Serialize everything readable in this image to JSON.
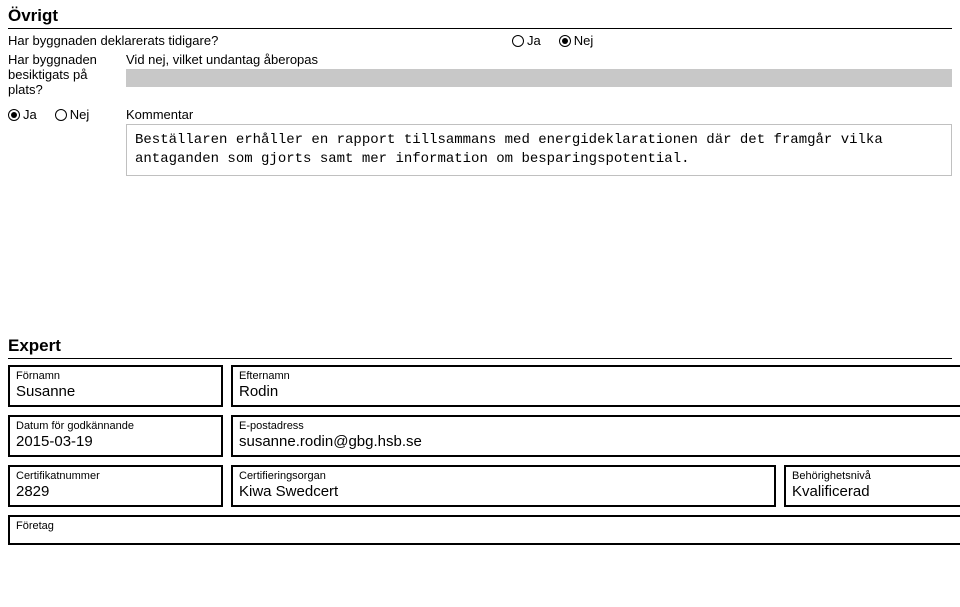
{
  "ovrigt": {
    "title": "Övrigt",
    "declared_label": "Har byggnaden deklarerats tidigare?",
    "ja": "Ja",
    "nej": "Nej",
    "inspected_label_l1": "Har byggnaden",
    "inspected_label_l2": "besiktigats på plats?",
    "vid_nej_label": "Vid nej, vilket undantag åberopas",
    "kommentar_label": "Kommentar",
    "kommentar_text": "Beställaren erhåller en rapport tillsammans med energideklarationen där det framgår vilka antaganden som gjorts samt mer information om besparingspotential."
  },
  "expert": {
    "title": "Expert",
    "fornamn_label": "Förnamn",
    "fornamn": "Susanne",
    "efternamn_label": "Efternamn",
    "efternamn": "Rodin",
    "datum_label": "Datum för godkännande",
    "datum": "2015-03-19",
    "epost_label": "E-postadress",
    "epost": "susanne.rodin@gbg.hsb.se",
    "cert_label": "Certifikatnummer",
    "cert": "2829",
    "org_label": "Certifieringsorgan",
    "org": "Kiwa Swedcert",
    "nivaa_label": "Behörighetsnivå",
    "nivaa": "Kvalificerad",
    "foretag_label": "Företag"
  }
}
